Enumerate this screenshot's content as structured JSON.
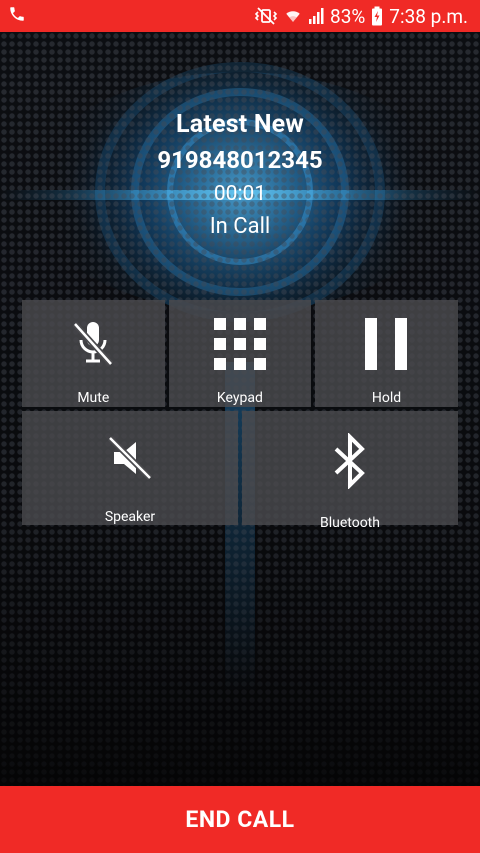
{
  "status_bar": {
    "battery_percent": "83%",
    "time": "7:38 p.m.",
    "icons": [
      "phone-icon",
      "vibrate-mute-icon",
      "wifi-icon",
      "signal-icon",
      "battery-charging-icon"
    ],
    "color": "#f02a26"
  },
  "caller": {
    "name": "Latest New",
    "number": "919848012345",
    "timer": "00:01",
    "state": "In Call"
  },
  "controls": {
    "mute_label": "Mute",
    "keypad_label": "Keypad",
    "hold_label": "Hold",
    "speaker_label": "Speaker",
    "bluetooth_label": "Bluetooth"
  },
  "end_call": {
    "label": "END CALL",
    "color": "#f02a26"
  }
}
